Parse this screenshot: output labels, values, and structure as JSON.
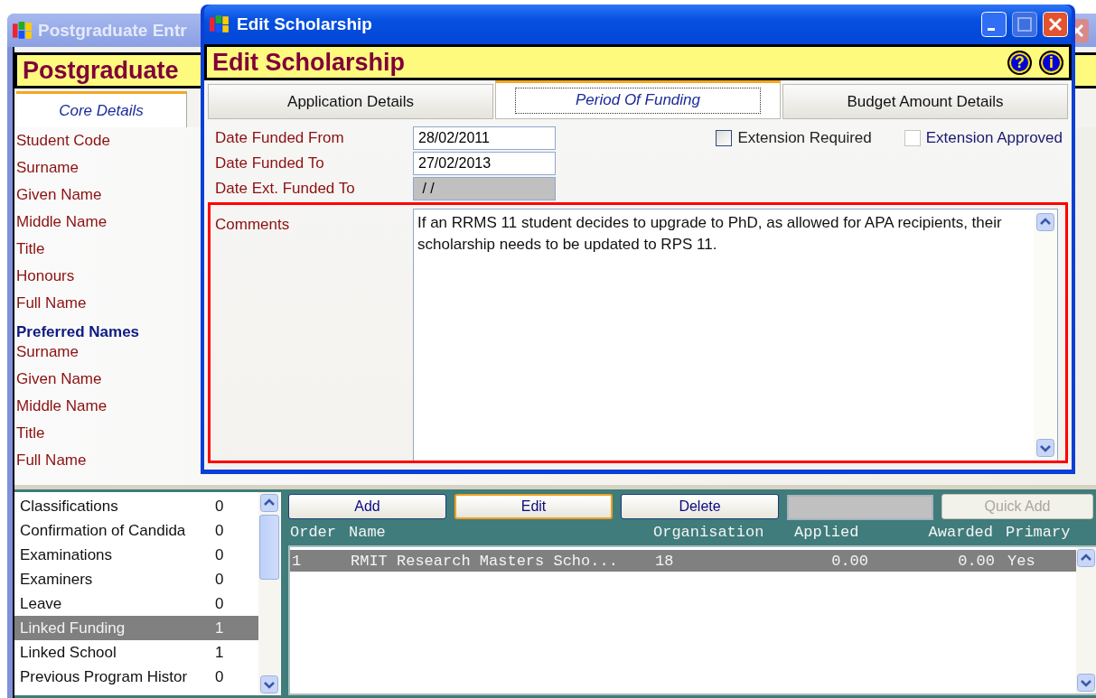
{
  "background_window": {
    "title": "Postgraduate Entr",
    "header": "Postgraduate",
    "tabs": [
      {
        "label": "Core Details",
        "selected": true
      }
    ],
    "fields": [
      {
        "label": "Student Code",
        "kind": "label"
      },
      {
        "label": "Surname",
        "kind": "label"
      },
      {
        "label": "Given Name",
        "kind": "label"
      },
      {
        "label": "Middle Name",
        "kind": "label"
      },
      {
        "label": "Title",
        "kind": "label"
      },
      {
        "label": "Honours",
        "kind": "label"
      },
      {
        "label": "Full Name",
        "kind": "label"
      },
      {
        "label": "Preferred Names",
        "kind": "heading"
      },
      {
        "label": "Surname",
        "kind": "label"
      },
      {
        "label": "Given Name",
        "kind": "label"
      },
      {
        "label": "Middle Name",
        "kind": "label"
      },
      {
        "label": "Title",
        "kind": "label"
      },
      {
        "label": "Full Name",
        "kind": "label"
      }
    ],
    "related_list": [
      {
        "name": "Classifications",
        "count": "0",
        "selected": false
      },
      {
        "name": "Confirmation of Candida",
        "count": "0",
        "selected": false
      },
      {
        "name": "Examinations",
        "count": "0",
        "selected": false
      },
      {
        "name": "Examiners",
        "count": "0",
        "selected": false
      },
      {
        "name": "Leave",
        "count": "0",
        "selected": false
      },
      {
        "name": "Linked Funding",
        "count": "1",
        "selected": true
      },
      {
        "name": "Linked School",
        "count": "1",
        "selected": false
      },
      {
        "name": "Previous Program Histor",
        "count": "0",
        "selected": false
      }
    ],
    "toolbar": [
      {
        "kind": "button",
        "label": "Add",
        "focused": false,
        "disabled": false
      },
      {
        "kind": "button",
        "label": "Edit",
        "focused": true,
        "disabled": false
      },
      {
        "kind": "button",
        "label": "Delete",
        "focused": false,
        "disabled": false
      },
      {
        "kind": "field",
        "disabled": true
      },
      {
        "kind": "button",
        "label": "Quick Add",
        "focused": false,
        "disabled": true
      }
    ],
    "table": {
      "columns": [
        "Order",
        "Name",
        "Organisation",
        "Applied",
        "Awarded",
        "Primary"
      ],
      "rows": [
        {
          "cells": [
            "1",
            "RMIT Research Masters Scho...",
            "18",
            "0.00",
            "0.00",
            "Yes"
          ],
          "selected": true
        }
      ]
    }
  },
  "dialog": {
    "title": "Edit Scholarship",
    "header": "Edit Scholarship",
    "header_buttons": [
      "?",
      "i"
    ],
    "tabs": [
      {
        "label": "Application Details",
        "selected": false
      },
      {
        "label": "Period Of Funding",
        "selected": true
      },
      {
        "label": "Budget Amount Details",
        "selected": false
      }
    ],
    "fields": [
      {
        "label": "Date Funded From",
        "value": "28/02/2011",
        "disabled": false
      },
      {
        "label": "Date Funded To",
        "value": "27/02/2013",
        "disabled": false
      },
      {
        "label": "Date Ext. Funded To",
        "value": " / /",
        "disabled": true
      }
    ],
    "checkboxes": [
      {
        "label": "Extension Required",
        "checked": false,
        "disabled": false
      },
      {
        "label": "Extension Approved",
        "checked": false,
        "disabled": true
      }
    ],
    "comments": {
      "label": "Comments",
      "value": "If an RRMS 11 student decides to upgrade to PhD, as allowed for APA recipients, their scholarship needs to be updated to RPS 11."
    }
  }
}
